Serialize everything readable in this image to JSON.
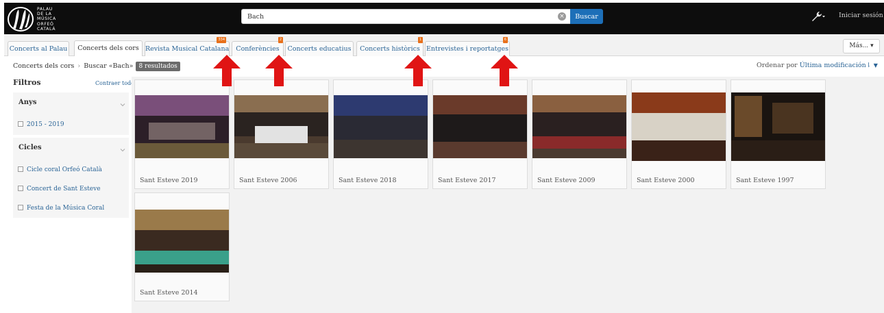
{
  "header": {
    "logo_lines": [
      "PALAU",
      "DE LA",
      "MÚSICA",
      "ORFEÓ",
      "CATALÀ"
    ],
    "search_value": "Bach",
    "search_button": "Buscar",
    "login": "Iniciar sesión",
    "icons": [
      "clear-icon",
      "wrench-icon",
      "caret-down-icon"
    ]
  },
  "tabs": [
    {
      "label": "Concerts al Palau",
      "badge": ""
    },
    {
      "label": "Concerts dels cors",
      "badge": ""
    },
    {
      "label": "Revista Musical Catalana",
      "badge": "334"
    },
    {
      "label": "Conferències",
      "badge": "2"
    },
    {
      "label": "Concerts educatius",
      "badge": ""
    },
    {
      "label": "Concerts històrics",
      "badge": "1"
    },
    {
      "label": "Entrevistes i reportatges",
      "badge": "6"
    }
  ],
  "more_button": "Más...",
  "breadcrumb": {
    "items": [
      "Concerts dels cors",
      "Buscar «Bach»"
    ],
    "results": "8 resultados"
  },
  "sort": {
    "label": "Ordenar por",
    "value": "Última modificación"
  },
  "filters": {
    "title": "Filtros",
    "collapse_all": "Contraer todo",
    "groups": [
      {
        "title": "Anys",
        "options": [
          "2015 - 2019"
        ]
      },
      {
        "title": "Cicles",
        "options": [
          "Cicle coral Orfeó Català",
          "Concert de Sant Esteve",
          "Festa de la Música Coral"
        ]
      }
    ]
  },
  "results": [
    {
      "title": "Sant Esteve 2019"
    },
    {
      "title": "Sant Esteve 2006"
    },
    {
      "title": "Sant Esteve 2018"
    },
    {
      "title": "Sant Esteve 2017"
    },
    {
      "title": "Sant Esteve 2009"
    },
    {
      "title": "Sant Esteve 2000"
    },
    {
      "title": "Sant Esteve 1997"
    },
    {
      "title": "Sant Esteve 2014"
    }
  ],
  "colors": {
    "topbar": "#0d0d0d",
    "search_button": "#1d6fb8",
    "link": "#2a6496",
    "badge": "#e8701a",
    "arrow": "#e01414"
  }
}
